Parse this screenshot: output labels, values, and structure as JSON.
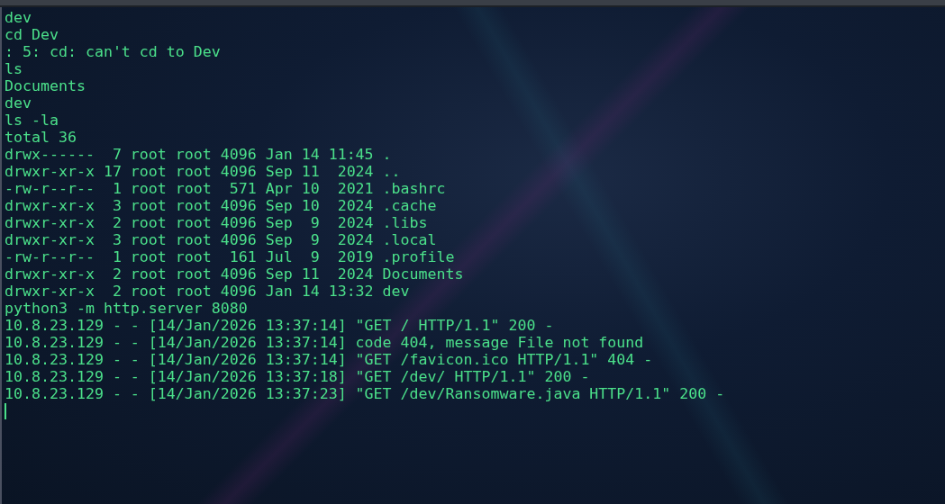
{
  "terminal": {
    "lines": [
      "dev",
      "cd Dev",
      ": 5: cd: can't cd to Dev",
      "ls",
      "Documents",
      "dev",
      "ls -la",
      "total 36",
      "drwx------  7 root root 4096 Jan 14 11:45 .",
      "drwxr-xr-x 17 root root 4096 Sep 11  2024 ..",
      "-rw-r--r--  1 root root  571 Apr 10  2021 .bashrc",
      "drwxr-xr-x  3 root root 4096 Sep 10  2024 .cache",
      "drwxr-xr-x  2 root root 4096 Sep  9  2024 .libs",
      "drwxr-xr-x  3 root root 4096 Sep  9  2024 .local",
      "-rw-r--r--  1 root root  161 Jul  9  2019 .profile",
      "drwxr-xr-x  2 root root 4096 Sep 11  2024 Documents",
      "drwxr-xr-x  2 root root 4096 Jan 14 13:32 dev",
      "python3 -m http.server 8080",
      "10.8.23.129 - - [14/Jan/2026 13:37:14] \"GET / HTTP/1.1\" 200 -",
      "10.8.23.129 - - [14/Jan/2026 13:37:14] code 404, message File not found",
      "10.8.23.129 - - [14/Jan/2026 13:37:14] \"GET /favicon.ico HTTP/1.1\" 404 -",
      "10.8.23.129 - - [14/Jan/2026 13:37:18] \"GET /dev/ HTTP/1.1\" 200 -",
      "10.8.23.129 - - [14/Jan/2026 13:37:23] \"GET /dev/Ransomware.java HTTP/1.1\" 200 -"
    ]
  }
}
